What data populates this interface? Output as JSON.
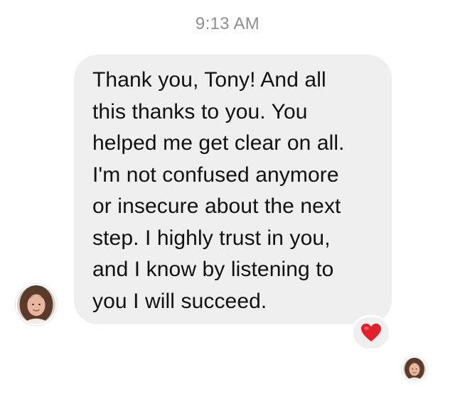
{
  "status": {
    "timestamp": "9:13 AM"
  },
  "message": {
    "text": "Thank you, Tony! And all\nthis thanks to you. You\nhelped me get clear on all.\nI'm not confused anymore\nor insecure about the next\nstep. I highly trust in you,\nand I know by listening to\nyou I will succeed.",
    "reaction_icon": "red-heart-icon",
    "reaction_color": "#e3202a",
    "bubble_color": "#efeff0"
  },
  "sender": {
    "avatar_icon": "profile-photo"
  },
  "read_receipt": {
    "avatar_icon": "profile-photo"
  }
}
